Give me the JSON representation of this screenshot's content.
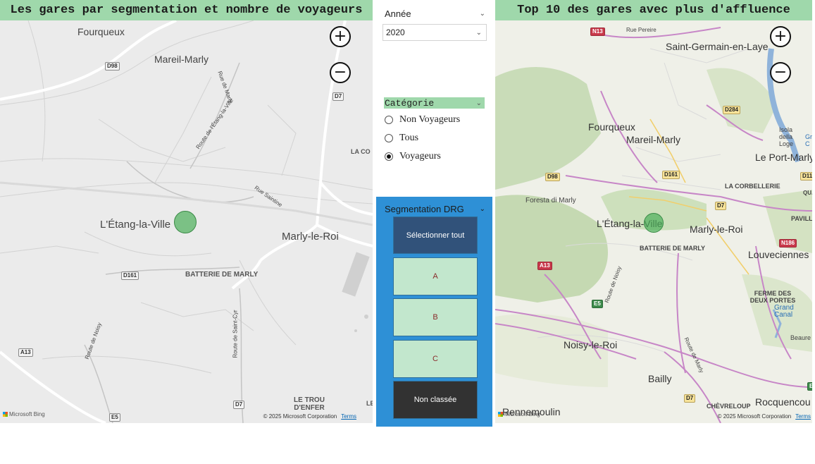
{
  "left_map": {
    "title": "Les gares par segmentation et nombre de voyageurs",
    "places": [
      "Fourqueux",
      "Mareil-Marly",
      "L'Étang-la-Ville",
      "Marly-le-Roi",
      "BATTERIE DE MARLY",
      "LA CO",
      "LE TROU D'ENFER",
      "LE"
    ],
    "streets": [
      "Rue de Marly",
      "Route de l'Étang-la-Ville",
      "Rue Saintine",
      "Route de Saint-Cyr",
      "Route de Noisy"
    ],
    "roads": [
      "D98",
      "D7",
      "D161",
      "A13",
      "D7",
      "E5"
    ],
    "attribution": "Microsoft Bing",
    "copyright": "© 2025 Microsoft Corporation",
    "terms": "Terms",
    "zoom_in": "+",
    "zoom_out": "−"
  },
  "right_map": {
    "title": "Top 10 des gares avec plus d'affluence",
    "places": [
      "Saint-Germain-en-Laye",
      "Fourqueux",
      "Mareil-Marly",
      "Le Port-Marly",
      "LA CORBELLERIE",
      "Foresta di Marly",
      "L'Étang-la-Ville",
      "Marly-le-Roi",
      "BATTERIE DE MARLY",
      "PAVILLO",
      "Louveciennes",
      "FERME DES DEUX PORTES",
      "Grand Canal",
      "Noisy-le-Roi",
      "Bailly",
      "Rennemoulin",
      "CHÈVRELOUP",
      "Rocquencou",
      "Beaure",
      "QUA",
      "Isola della Loge",
      "Gr C"
    ],
    "streets": [
      "Rue Pereire",
      "Route de Noisy",
      "Route de Marly"
    ],
    "roads": [
      "N13",
      "D284",
      "D98",
      "D161",
      "D7",
      "A13",
      "E5",
      "N186",
      "D113",
      "D7",
      "E"
    ],
    "attribution": "Microsoft Bing",
    "copyright": "© 2025 Microsoft Corporation",
    "terms": "Terms",
    "zoom_in": "+",
    "zoom_out": "−"
  },
  "year_slicer": {
    "label": "Année",
    "selected": "2020"
  },
  "category_slicer": {
    "label": "Catégorie",
    "options": [
      {
        "label": "Non Voyageurs",
        "selected": false
      },
      {
        "label": "Tous",
        "selected": false
      },
      {
        "label": "Voyageurs",
        "selected": true
      }
    ]
  },
  "segmentation_slicer": {
    "label": "Segmentation DRG",
    "buttons": [
      "Sélectionner tout",
      "A",
      "B",
      "C",
      "Non classée"
    ]
  },
  "colors": {
    "title_bg": "#9fd8ab",
    "slicer_panel": "#2e90d6",
    "button_selected": "#c2e7cd",
    "button_dark": "#31527a",
    "button_black": "#323232",
    "bubble": "#4caf5a"
  },
  "icons": {
    "chevron": "chevron-down-icon",
    "zoom_in": "zoom-in-icon",
    "zoom_out": "zoom-out-icon"
  }
}
